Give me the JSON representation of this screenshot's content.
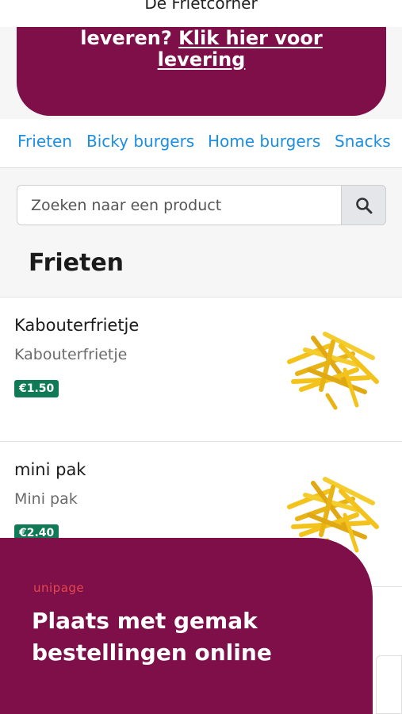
{
  "header": {
    "title": "De Frietcorner"
  },
  "banner": {
    "text_before": "leveren? ",
    "link_line1": "Klik hier voor",
    "link_line2": "levering"
  },
  "categories": [
    "Frieten",
    "Bicky burgers",
    "Home burgers",
    "Snacks"
  ],
  "search": {
    "placeholder": "Zoeken naar een product",
    "icon": "search-icon"
  },
  "section": {
    "title": "Frieten"
  },
  "products": [
    {
      "name": "Kabouterfrietje",
      "description": "Kabouterfrietje",
      "price": "€1.50",
      "image": "fries-image"
    },
    {
      "name": "mini pak",
      "description": "Mini pak",
      "price": "€2.40",
      "image": "fries-image"
    }
  ],
  "promo": {
    "brand": "unipage",
    "headline_line1": "Plaats met gemak",
    "headline_line2": "bestellingen online"
  },
  "colors": {
    "brand": "#7e0f48",
    "link": "#1c8fe3",
    "price_badge": "#0f7a55",
    "fries": "#f3c21b"
  }
}
